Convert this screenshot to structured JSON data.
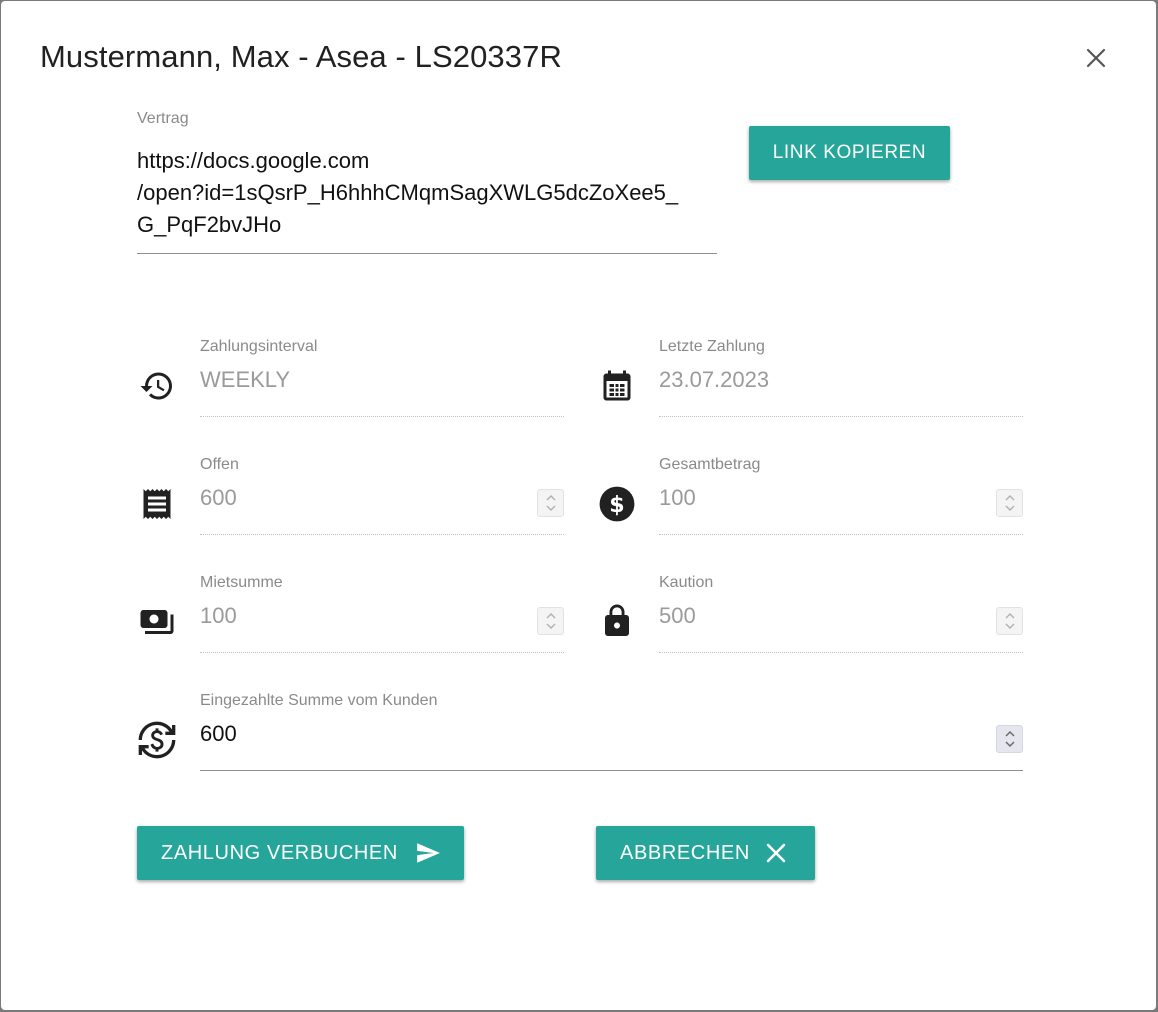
{
  "dialog": {
    "title": "Mustermann, Max - Asea - LS20337R"
  },
  "contract": {
    "label": "Vertrag",
    "value": "https://docs.google.com\n/open?id=1sQsrP_H6hhhCMqmSagXWLG5dcZoXee5_\nG_PqF2bvJHo",
    "copy_button": "LINK KOPIEREN"
  },
  "fields": {
    "interval": {
      "label": "Zahlungsinterval",
      "value": "WEEKLY",
      "icon": "history-icon"
    },
    "last_payment": {
      "label": "Letzte Zahlung",
      "value": "23.07.2023",
      "icon": "calendar-icon"
    },
    "open": {
      "label": "Offen",
      "value": "600",
      "icon": "receipt-icon"
    },
    "total": {
      "label": "Gesamtbetrag",
      "value": "100",
      "icon": "dollar-circle-icon"
    },
    "rent_sum": {
      "label": "Mietsumme",
      "value": "100",
      "icon": "payments-icon"
    },
    "deposit": {
      "label": "Kaution",
      "value": "500",
      "icon": "lock-icon"
    },
    "paid": {
      "label": "Eingezahlte Summe vom Kunden",
      "value": "600",
      "icon": "currency-exchange-icon"
    }
  },
  "actions": {
    "submit": "ZAHLUNG VERBUCHEN",
    "cancel": "ABBRECHEN"
  },
  "colors": {
    "accent": "#26a69a",
    "icon": "#212121"
  }
}
